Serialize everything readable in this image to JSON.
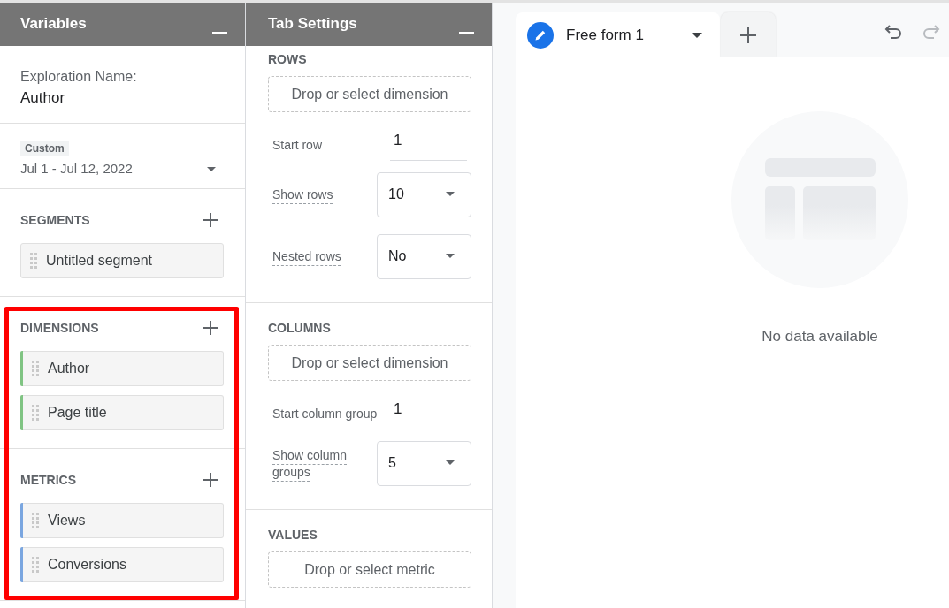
{
  "variables": {
    "title": "Variables",
    "exploration_label": "Exploration Name:",
    "exploration_name": "Author",
    "date_range": {
      "badge": "Custom",
      "value": "Jul 1 - Jul 12, 2022"
    },
    "sections": [
      {
        "title": "SEGMENTS",
        "highlighted": false,
        "items": [
          {
            "label": "Untitled segment"
          }
        ]
      },
      {
        "title": "DIMENSIONS",
        "highlighted": true,
        "items": [
          {
            "label": "Author",
            "color": "#80c483"
          },
          {
            "label": "Page title",
            "color": "#80c483"
          }
        ]
      },
      {
        "title": "METRICS",
        "highlighted": true,
        "items": [
          {
            "label": "Views",
            "color": "#7aa6e0"
          },
          {
            "label": "Conversions",
            "color": "#7aa6e0"
          }
        ]
      }
    ]
  },
  "tab_settings": {
    "title": "Tab Settings",
    "groups": [
      {
        "title": "ROWS",
        "drop_zone": "Drop or select dimension",
        "fields": [
          {
            "kind": "input",
            "label": "Start row",
            "value": "1"
          },
          {
            "kind": "select",
            "label": "Show rows",
            "value": "10"
          },
          {
            "kind": "select",
            "label": "Nested rows",
            "value": "No"
          }
        ]
      },
      {
        "title": "COLUMNS",
        "drop_zone": "Drop or select dimension",
        "fields": [
          {
            "kind": "input",
            "label": "Start column group",
            "value": "1"
          },
          {
            "kind": "select",
            "label": "Show column groups",
            "value": "5"
          }
        ]
      },
      {
        "title": "VALUES",
        "drop_zone": "Drop or select metric"
      }
    ]
  },
  "canvas": {
    "tabs": [
      {
        "label": "Free form 1",
        "selected": true
      }
    ],
    "toolbar": [
      {
        "kind": "undo",
        "disabled": false
      },
      {
        "kind": "redo",
        "disabled": true
      }
    ],
    "empty_message": "No data available"
  }
}
